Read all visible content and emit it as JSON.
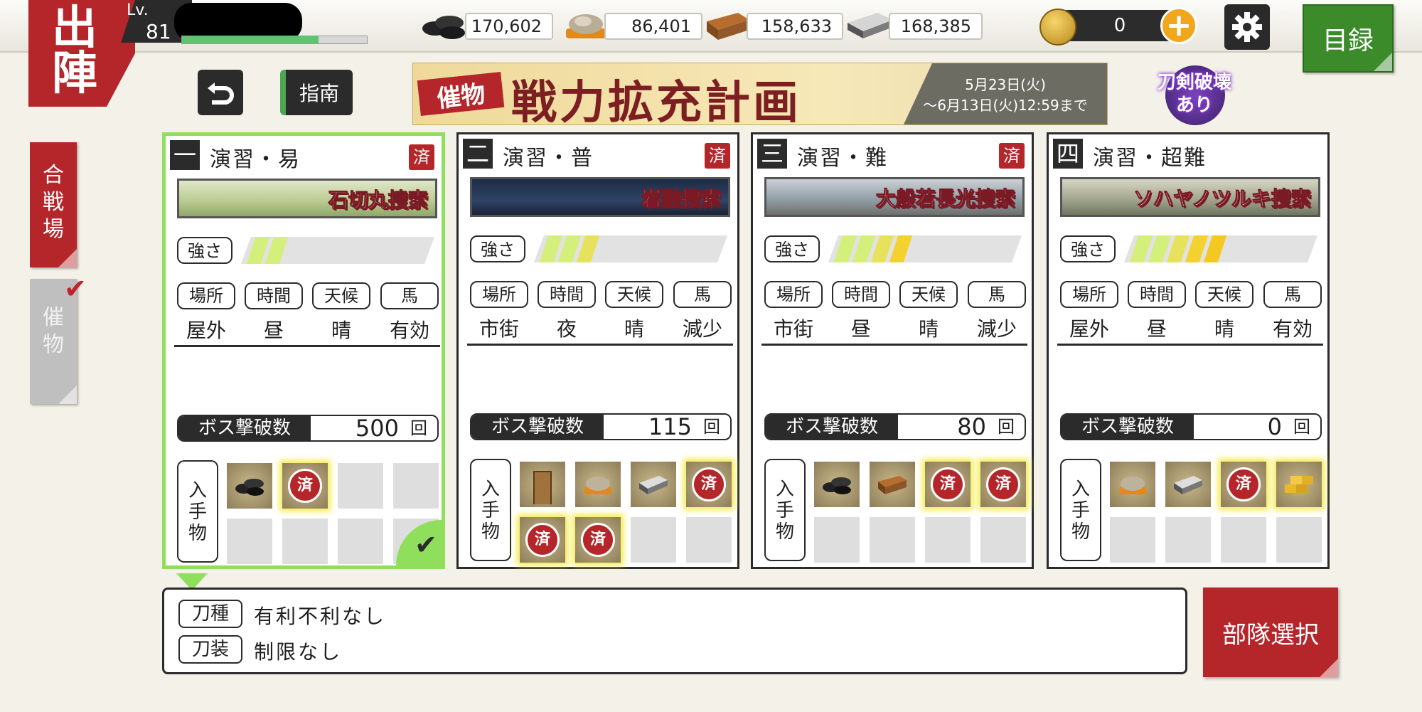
{
  "header": {
    "sortie_title": [
      "出",
      "陣"
    ],
    "level_label": "Lv.",
    "level": "81",
    "xp_fraction": 0.74,
    "resources": [
      {
        "icon": "charcoal-icon",
        "value": "170,602"
      },
      {
        "icon": "coolant-icon",
        "value": "86,401"
      },
      {
        "icon": "whetstone-icon",
        "value": "158,633"
      },
      {
        "icon": "steel-icon",
        "value": "168,385"
      }
    ],
    "coins": "0",
    "catalog_label": "目録"
  },
  "toolbar": {
    "guide_label": "指南"
  },
  "event_banner": {
    "tag": "催物",
    "title": "戦力拡充計画",
    "date_start": "5月23日(火)",
    "date_end": "～6月13日(火)12:59まで"
  },
  "break_badge": [
    "刀剣破壊",
    "あり"
  ],
  "side_tabs": {
    "battle": [
      "合",
      "戦",
      "場"
    ],
    "event": [
      "催",
      "物"
    ]
  },
  "colors": {
    "accent_red": "#b5262b",
    "selected_green": "#8fdf5d",
    "catalog_green": "#3b8b2b"
  },
  "card_labels": {
    "strength": "強さ",
    "conditions": [
      "場所",
      "時間",
      "天候",
      "馬"
    ],
    "boss_label": "ボス撃破数",
    "boss_unit": "回",
    "drops_label": [
      "入",
      "手",
      "物"
    ],
    "done_mark": "済"
  },
  "cards": [
    {
      "num": "一",
      "name": "演習・易",
      "done": true,
      "map_label": "石切丸捜索",
      "strength": 2,
      "conditions": [
        "屋外",
        "昼",
        "晴",
        "有効"
      ],
      "boss_count": "500",
      "selected": true,
      "drops": [
        "charcoal",
        "stamp",
        "",
        "",
        "",
        "",
        "",
        ""
      ]
    },
    {
      "num": "二",
      "name": "演習・普",
      "done": true,
      "map_label": "岩融捜索",
      "strength": 3,
      "conditions": [
        "市街",
        "夜",
        "晴",
        "減少"
      ],
      "boss_count": "115",
      "selected": false,
      "drops": [
        "talisman",
        "coolant",
        "steel",
        "stamp",
        "stamp",
        "stamp",
        "",
        ""
      ]
    },
    {
      "num": "三",
      "name": "演習・難",
      "done": true,
      "map_label": "大般若長光捜索",
      "strength": 4,
      "conditions": [
        "市街",
        "昼",
        "晴",
        "減少"
      ],
      "boss_count": "80",
      "selected": false,
      "drops": [
        "charcoal",
        "whetstone",
        "stamp",
        "stamp",
        "",
        "",
        "",
        ""
      ]
    },
    {
      "num": "四",
      "name": "演習・超難",
      "done": false,
      "map_label": "ソハヤノツルキ捜索",
      "strength": 5,
      "conditions": [
        "屋外",
        "昼",
        "晴",
        "有効"
      ],
      "boss_count": "0",
      "selected": false,
      "drops": [
        "coolant",
        "steel",
        "stamp",
        "gold",
        "",
        "",
        "",
        ""
      ]
    }
  ],
  "info": {
    "blade_type_label": "刀種",
    "blade_type_value": "有利不利なし",
    "equipment_label": "刀装",
    "equipment_value": "制限なし"
  },
  "squad_button": "部隊選択"
}
